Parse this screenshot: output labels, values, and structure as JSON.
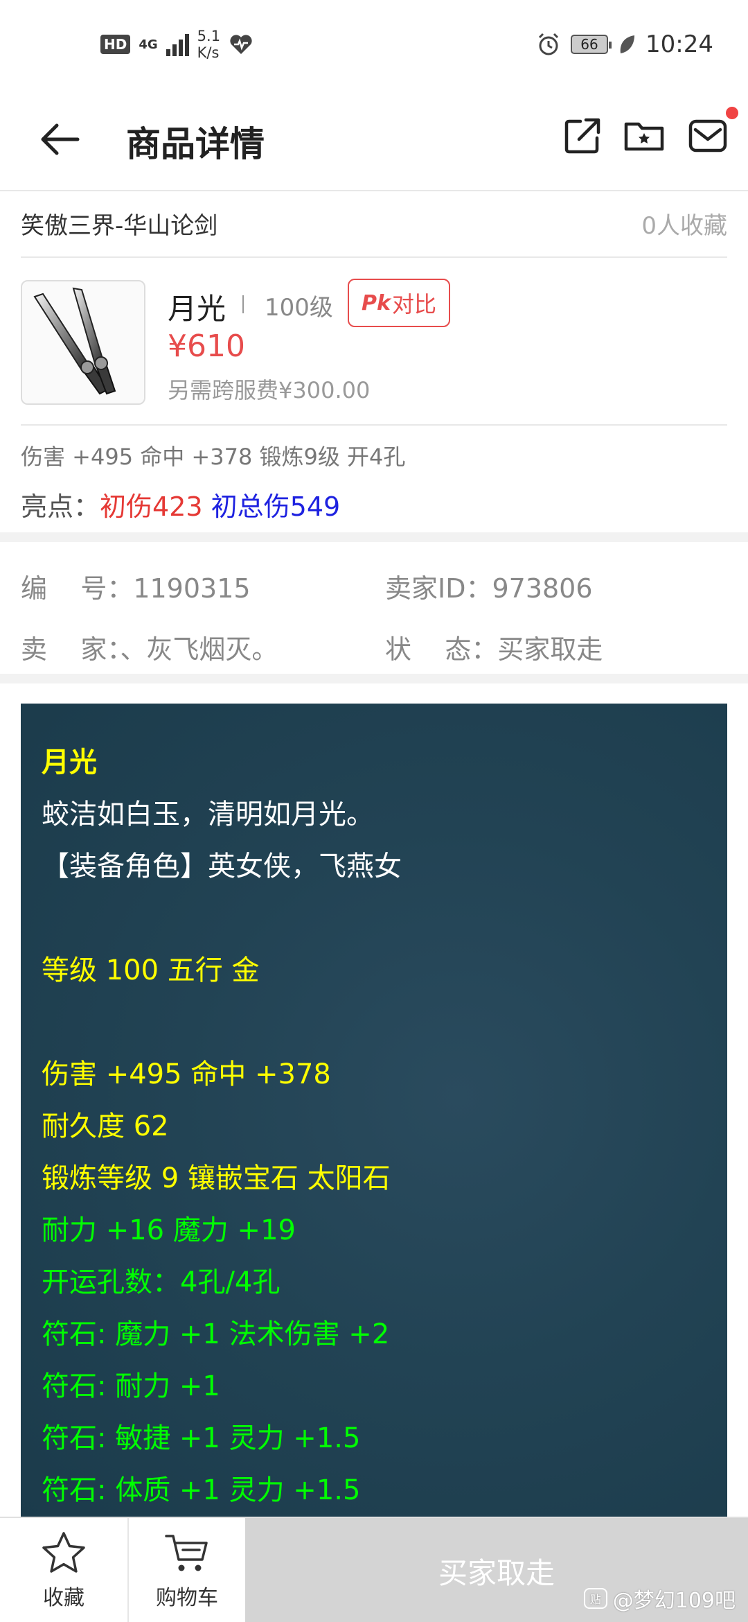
{
  "status_bar": {
    "hd": "HD",
    "network": "4G",
    "speed_value": "5.1",
    "speed_unit": "K/s",
    "battery": "66",
    "time": "10:24"
  },
  "header": {
    "title": "商品详情"
  },
  "server": {
    "name": "笑傲三界-华山论剑",
    "favorites": "0人收藏"
  },
  "item": {
    "name": "月光",
    "level": "100级",
    "pk_prefix": "Pk",
    "pk_label": "对比",
    "price": "¥610",
    "fee": "另需跨服费¥300.00"
  },
  "stats": {
    "summary": "伤害 +495 命中 +378 锻炼9级 开4孔",
    "highlight_label": "亮点：",
    "highlight_1": "初伤423",
    "highlight_2": "初总伤549"
  },
  "info": {
    "id_label": "编    号：",
    "id_value": "1190315",
    "seller_id_label": "卖家ID：",
    "seller_id_value": "973806",
    "seller_label": "卖    家：",
    "seller_value": "、灰飞烟灭。",
    "status_label": "状    态：",
    "status_value": "买家取走"
  },
  "description": {
    "title": "月光",
    "line1": "蛟洁如白玉，清明如月光。",
    "line2": "【装备角色】英女侠，飞燕女",
    "line3": "等级 100 五行 金",
    "line4": "伤害 +495 命中 +378",
    "line5": "耐久度 62",
    "line6": "锻炼等级 9 镶嵌宝石 太阳石",
    "line7": "耐力 +16 魔力 +19",
    "line8": "开运孔数：4孔/4孔",
    "line9": "符石: 魔力 +1 法术伤害 +2",
    "line10": "符石: 耐力 +1",
    "line11": "符石: 敏捷 +1 灵力 +1.5",
    "line12": "符石: 体质 +1 灵力 +1.5"
  },
  "bottom": {
    "fav_label": "收藏",
    "cart_label": "购物车",
    "buy_label": "买家取走",
    "watermark": "@梦幻109吧"
  }
}
